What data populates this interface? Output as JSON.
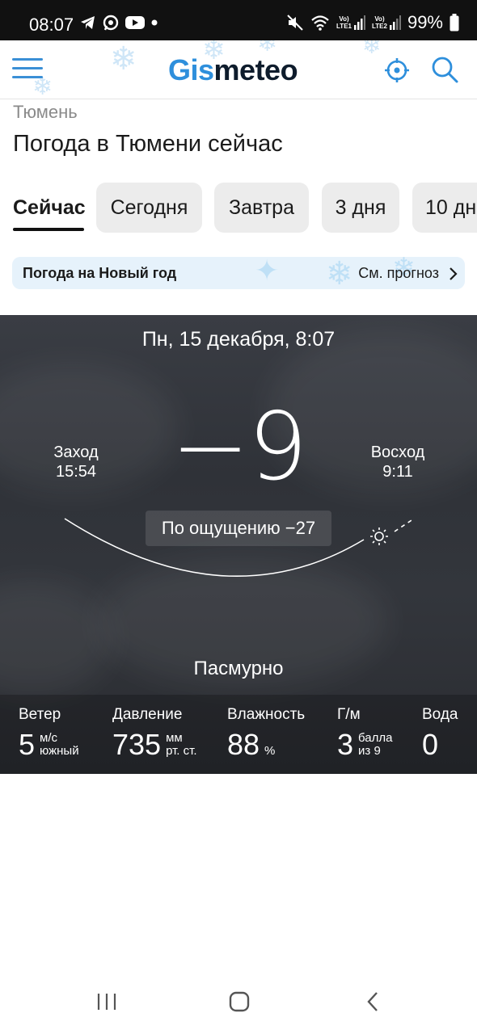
{
  "status_bar": {
    "time": "08:07",
    "battery": "99%",
    "sim1": "LTE1",
    "sim2": "LTE2",
    "volte": "Vo)"
  },
  "header": {
    "logo_gis": "Gis",
    "logo_meteo": "meteo"
  },
  "breadcrumb_city": "Тюмень",
  "page_title": "Погода в Тюмени сейчас",
  "tabs": [
    {
      "label": "Сейчас",
      "active": true
    },
    {
      "label": "Сегодня",
      "active": false
    },
    {
      "label": "Завтра",
      "active": false
    },
    {
      "label": "3 дня",
      "active": false
    },
    {
      "label": "10 дн",
      "active": false
    }
  ],
  "promo": {
    "label": "Погода на Новый год",
    "link": "См. прогноз"
  },
  "weather": {
    "date": "Пн, 15 декабря, 8:07",
    "sunset_label": "Заход",
    "sunset_time": "15:54",
    "sunrise_label": "Восход",
    "sunrise_time": "9:11",
    "temperature": "−9",
    "feels_like": "По ощущению −27",
    "condition": "Пасмурно"
  },
  "stats": [
    {
      "label": "Ветер",
      "value": "5",
      "unit1": "м/с",
      "unit2": "южный"
    },
    {
      "label": "Давление",
      "value": "735",
      "unit1": "мм",
      "unit2": "рт. ст."
    },
    {
      "label": "Влажность",
      "value": "88",
      "unit1": "",
      "unit2": "%"
    },
    {
      "label": "Г/м",
      "value": "3",
      "unit1": "балла",
      "unit2": "из 9"
    },
    {
      "label": "Вода",
      "value": "0",
      "unit1": "",
      "unit2": ""
    }
  ],
  "colors": {
    "brand_blue": "#2e8fdc",
    "logo_dark": "#0e1c2c",
    "card_bg": "#33363c",
    "tab_bg": "#ececec",
    "promo_bg": "#e6f2fb"
  }
}
